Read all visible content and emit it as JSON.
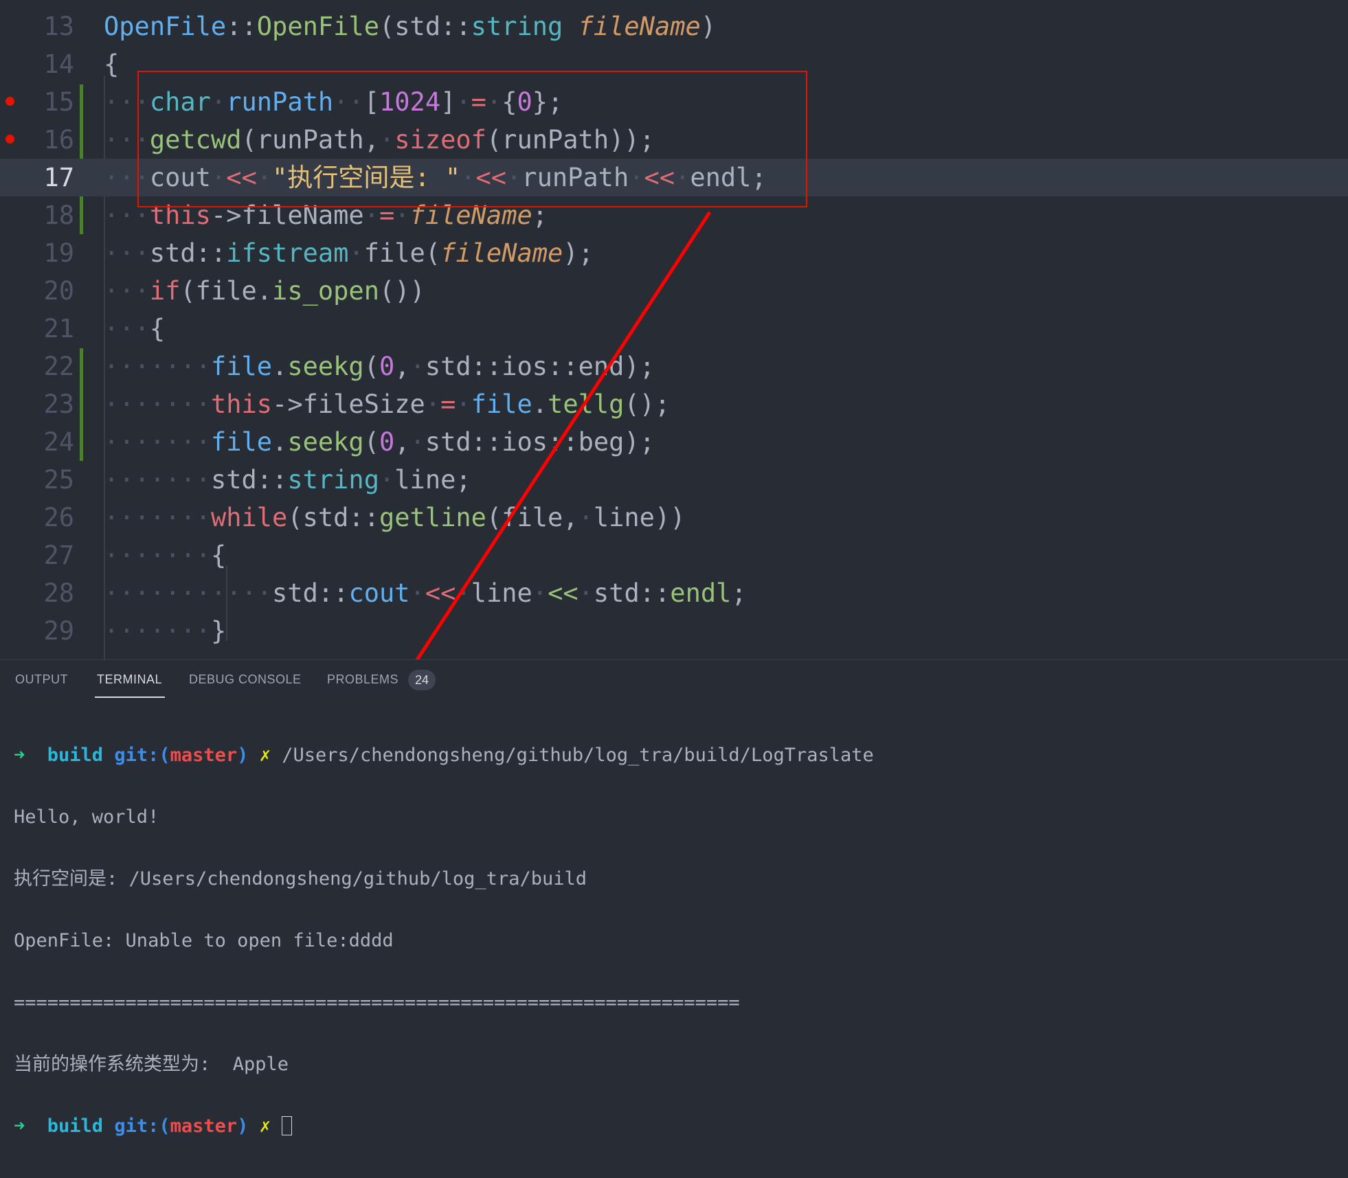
{
  "editor": {
    "current_line": 17,
    "lines": [
      {
        "n": "13",
        "tokens": [
          [
            "t-blue",
            "OpenFile"
          ],
          [
            "t-plain",
            "::"
          ],
          [
            "t-green",
            "OpenFile"
          ],
          [
            "t-plain",
            "(std::"
          ],
          [
            "t-cyan",
            "string"
          ],
          [
            "ws",
            " "
          ],
          [
            "t-orange",
            "fileName"
          ],
          [
            "t-plain",
            ")"
          ]
        ]
      },
      {
        "n": "14",
        "tokens": [
          [
            "t-plain",
            "{"
          ]
        ]
      },
      {
        "n": "15",
        "breakpoint": true,
        "tokens": [
          [
            "ws",
            "···"
          ],
          [
            "t-cyan",
            "char"
          ],
          [
            "ws",
            "·"
          ],
          [
            "t-blue",
            "runPath"
          ],
          [
            "ws",
            "··"
          ],
          [
            "t-plain",
            "["
          ],
          [
            "t-kw2",
            "1024"
          ],
          [
            "t-plain",
            "]"
          ],
          [
            "ws",
            "·"
          ],
          [
            "t-op",
            "="
          ],
          [
            "ws",
            "·"
          ],
          [
            "t-plain",
            "{"
          ],
          [
            "t-kw2",
            "0"
          ],
          [
            "t-plain",
            "};"
          ]
        ]
      },
      {
        "n": "16",
        "breakpoint": true,
        "tokens": [
          [
            "ws",
            "···"
          ],
          [
            "t-green",
            "getcwd"
          ],
          [
            "t-plain",
            "(runPath,"
          ],
          [
            "ws",
            "·"
          ],
          [
            "t-keyword",
            "sizeof"
          ],
          [
            "t-plain",
            "(runPath));"
          ]
        ]
      },
      {
        "n": "17",
        "tokens": [
          [
            "ws",
            "···"
          ],
          [
            "t-plain",
            "cout"
          ],
          [
            "ws",
            "·"
          ],
          [
            "t-op",
            "<<"
          ],
          [
            "ws",
            "·"
          ],
          [
            "t-str",
            "\"执行空间是: \""
          ],
          [
            "ws",
            "·"
          ],
          [
            "t-op",
            "<<"
          ],
          [
            "ws",
            "·"
          ],
          [
            "t-plain",
            "runPath"
          ],
          [
            "ws",
            "·"
          ],
          [
            "t-op",
            "<<"
          ],
          [
            "ws",
            "·"
          ],
          [
            "t-plain",
            "endl;"
          ]
        ]
      },
      {
        "n": "18",
        "tokens": [
          [
            "ws",
            "···"
          ],
          [
            "t-keyword",
            "this"
          ],
          [
            "t-plain",
            "->fileName"
          ],
          [
            "ws",
            "·"
          ],
          [
            "t-op",
            "="
          ],
          [
            "ws",
            "·"
          ],
          [
            "t-orange",
            "fileName"
          ],
          [
            "t-plain",
            ";"
          ]
        ]
      },
      {
        "n": "19",
        "tokens": [
          [
            "ws",
            "···"
          ],
          [
            "t-plain",
            "std::"
          ],
          [
            "t-cyan",
            "ifstream"
          ],
          [
            "ws",
            "·"
          ],
          [
            "t-plain",
            "file("
          ],
          [
            "t-orange",
            "fileName"
          ],
          [
            "t-plain",
            ");"
          ]
        ]
      },
      {
        "n": "20",
        "tokens": [
          [
            "ws",
            "···"
          ],
          [
            "t-keyword",
            "if"
          ],
          [
            "t-plain",
            "(file."
          ],
          [
            "t-green",
            "is_open"
          ],
          [
            "t-plain",
            "())"
          ]
        ]
      },
      {
        "n": "21",
        "tokens": [
          [
            "ws",
            "···"
          ],
          [
            "t-plain",
            "{"
          ]
        ]
      },
      {
        "n": "22",
        "tokens": [
          [
            "ws",
            "·······"
          ],
          [
            "t-blue",
            "file"
          ],
          [
            "t-plain",
            "."
          ],
          [
            "t-green",
            "seekg"
          ],
          [
            "t-plain",
            "("
          ],
          [
            "t-kw2",
            "0"
          ],
          [
            "t-plain",
            ","
          ],
          [
            "ws",
            "·"
          ],
          [
            "t-plain",
            "std::ios::end);"
          ]
        ]
      },
      {
        "n": "23",
        "tokens": [
          [
            "ws",
            "·······"
          ],
          [
            "t-keyword",
            "this"
          ],
          [
            "t-plain",
            "->fileSize"
          ],
          [
            "ws",
            "·"
          ],
          [
            "t-op",
            "="
          ],
          [
            "ws",
            "·"
          ],
          [
            "t-blue",
            "file"
          ],
          [
            "t-plain",
            "."
          ],
          [
            "t-green",
            "tellg"
          ],
          [
            "t-plain",
            "();"
          ]
        ]
      },
      {
        "n": "24",
        "tokens": [
          [
            "ws",
            "·······"
          ],
          [
            "t-blue",
            "file"
          ],
          [
            "t-plain",
            "."
          ],
          [
            "t-green",
            "seekg"
          ],
          [
            "t-plain",
            "("
          ],
          [
            "t-kw2",
            "0"
          ],
          [
            "t-plain",
            ","
          ],
          [
            "ws",
            "·"
          ],
          [
            "t-plain",
            "std::ios::beg);"
          ]
        ]
      },
      {
        "n": "25",
        "tokens": [
          [
            "ws",
            "·······"
          ],
          [
            "t-plain",
            "std::"
          ],
          [
            "t-cyan",
            "string"
          ],
          [
            "ws",
            "·"
          ],
          [
            "t-plain",
            "line;"
          ]
        ]
      },
      {
        "n": "26",
        "tokens": [
          [
            "ws",
            "·······"
          ],
          [
            "t-keyword",
            "while"
          ],
          [
            "t-plain",
            "(std::"
          ],
          [
            "t-green",
            "getline"
          ],
          [
            "t-plain",
            "(file,"
          ],
          [
            "ws",
            "·"
          ],
          [
            "t-plain",
            "line))"
          ]
        ]
      },
      {
        "n": "27",
        "tokens": [
          [
            "ws",
            "·······"
          ],
          [
            "t-plain",
            "{"
          ]
        ]
      },
      {
        "n": "28",
        "tokens": [
          [
            "ws",
            "···········"
          ],
          [
            "t-plain",
            "std::"
          ],
          [
            "t-blue",
            "cout"
          ],
          [
            "ws",
            "·"
          ],
          [
            "t-op",
            "<<"
          ],
          [
            "ws",
            "·"
          ],
          [
            "t-plain",
            "line"
          ],
          [
            "ws",
            "·"
          ],
          [
            "t-green",
            "<<"
          ],
          [
            "ws",
            "·"
          ],
          [
            "t-plain",
            "std::"
          ],
          [
            "t-green",
            "endl"
          ],
          [
            "t-plain",
            ";"
          ]
        ]
      },
      {
        "n": "29",
        "tokens": [
          [
            "ws",
            "·······"
          ],
          [
            "t-plain",
            "}"
          ]
        ]
      }
    ]
  },
  "panel": {
    "tabs": [
      {
        "label": "OUTPUT",
        "active": false
      },
      {
        "label": "TERMINAL",
        "active": true
      },
      {
        "label": "DEBUG CONSOLE",
        "active": false
      },
      {
        "label": "PROBLEMS",
        "active": false
      }
    ],
    "problems_count": "24"
  },
  "terminal": {
    "prompt_arrow": "➜",
    "prompt_dir": "build",
    "prompt_git": "git:(",
    "prompt_branch": "master",
    "prompt_git_close": ")",
    "prompt_dirty": "✗",
    "command": "/Users/chendongsheng/github/log_tra/build/LogTraslate",
    "output": [
      "Hello, world!",
      "执行空间是: /Users/chendongsheng/github/log_tra/build",
      "OpenFile: Unable to open file:dddd",
      "=================================================================",
      "当前的操作系统类型为:  Apple"
    ]
  },
  "colors": {
    "annotation_red": "#e51400",
    "editor_bg": "#282c34",
    "current_line_bg": "#343a46"
  }
}
